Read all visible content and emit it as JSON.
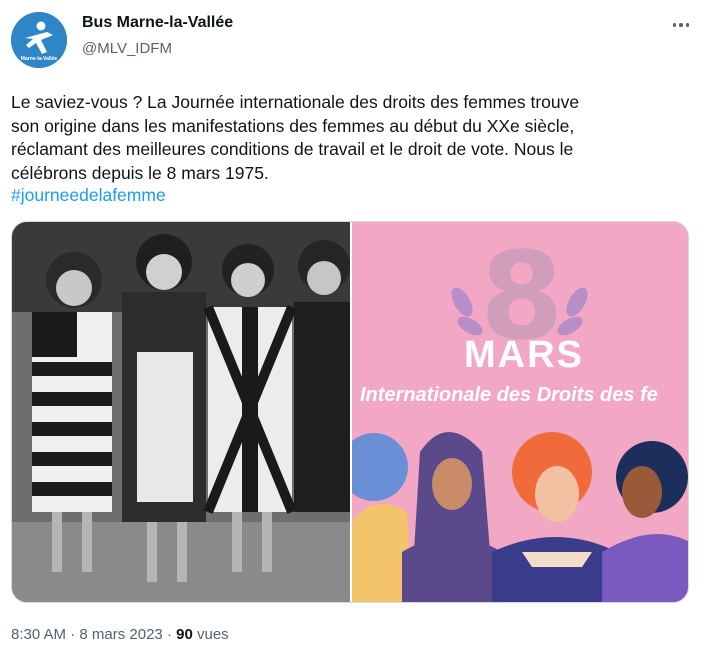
{
  "author": {
    "name": "Bus Marne-la-Vallée",
    "handle": "@MLV_IDFM",
    "avatar_label": "Marne-la-Vallée",
    "avatar_color": "#2e86c6"
  },
  "more_icon": "more-horizontal-icon",
  "tweet": {
    "text": "Le saviez-vous ? La Journée internationale des droits des femmes trouve\nson origine dans les manifestations des femmes au début du XXe siècle,\nréclamant des meilleures conditions de travail et le droit de vote. Nous le\ncélébrons depuis le 8 mars 1975.",
    "hashtag": "#journeedelafemme"
  },
  "media": {
    "right_number": "8",
    "right_title": "MARS",
    "right_subtitle": "Internationale des Droits des fe"
  },
  "footer": {
    "time": "8:30 AM",
    "sep1": " · ",
    "date": "8 mars 2023",
    "sep2": " · ",
    "views_count": "90",
    "views_label": " vues"
  },
  "colors": {
    "link": "#1d9bf0",
    "secondary_text": "#536471",
    "media_pink": "#f2a8c4"
  }
}
